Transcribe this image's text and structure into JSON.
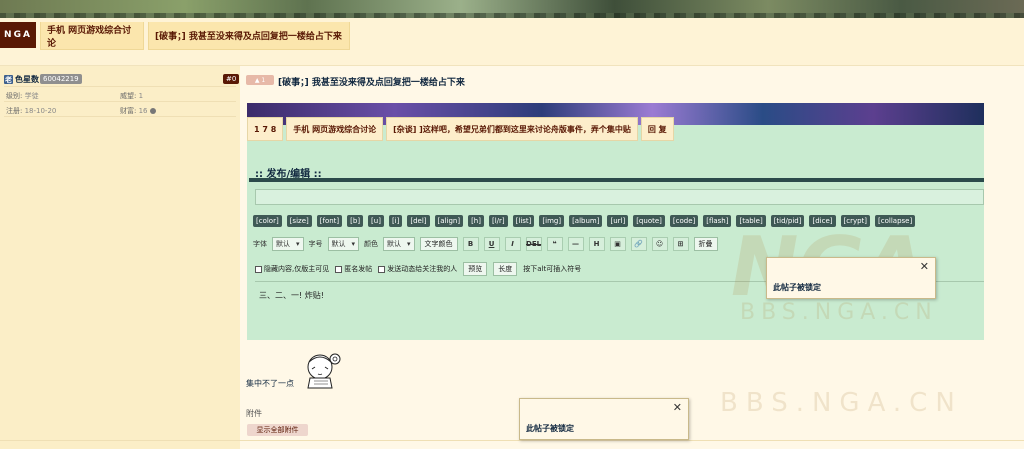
{
  "header": {
    "logo": "NGA",
    "crumbs": [
      "手机 网页游戏综合讨论",
      "[破事；] 我甚至没来得及点回复把一楼给占下来"
    ]
  },
  "user": {
    "avatar_glyph": "老",
    "name": "色星数",
    "uid": "60042219",
    "floor": "#0",
    "level_label": "级别:",
    "level_value": "学徒",
    "prestige_label": "威望:",
    "prestige_value": "1",
    "reg_label": "注册:",
    "reg_value": "18-10-20",
    "wealth_label": "财富:",
    "wealth_value": "16"
  },
  "post": {
    "like_badge": "1",
    "title": "[破事；] 我甚至没来得及点回复把一楼给占下来"
  },
  "embedded": {
    "tabs": [
      "1 7 8",
      "手机 网页游戏综合讨论",
      "[杂谈] ]这样吧，希望兄弟们都到这里来讨论舟版事件，弄个集中贴",
      "回 复"
    ],
    "heading": ":: 发布/编辑 ::",
    "bbcodes": [
      "[color]",
      "[size]",
      "[font]",
      "[b]",
      "[u]",
      "[i]",
      "[del]",
      "[align]",
      "[h]",
      "[l/r]",
      "[list]",
      "[img]",
      "[album]",
      "[url]",
      "[quote]",
      "[code]",
      "[flash]",
      "[table]",
      "[tid/pid]",
      "[dice]",
      "[crypt]",
      "[collapse]"
    ],
    "font_label": "字体",
    "font_value": "默认",
    "size_label": "字号",
    "size_value": "默认",
    "color_label": "颜色",
    "color_value": "默认",
    "text_color_btn": "文字颜色",
    "icon_buttons": [
      "B",
      "U",
      "I",
      "DEL",
      "❝",
      "—",
      "H",
      "▣",
      "🔗",
      "☺",
      "⊞"
    ],
    "fold_btn": "折叠",
    "opt_hide": "隐藏内容,仅版主可见",
    "opt_anon": "匿名发帖",
    "opt_notify": "发送动态给关注我的人",
    "preview_btn": "预览",
    "length_btn": "长度",
    "hint": "按下alt可插入符号",
    "content": "三、二、一! 炸贴!"
  },
  "signature": {
    "text": "集中不了一点"
  },
  "attachment": {
    "label": "附件",
    "show_all": "显示全部附件"
  },
  "dialogs": [
    {
      "message": "此帖子被锁定",
      "close": "✕"
    },
    {
      "message": "此帖子被锁定",
      "close": "✕"
    }
  ],
  "watermark": {
    "big": "NGA",
    "small": "BBS.NGA.CN"
  }
}
